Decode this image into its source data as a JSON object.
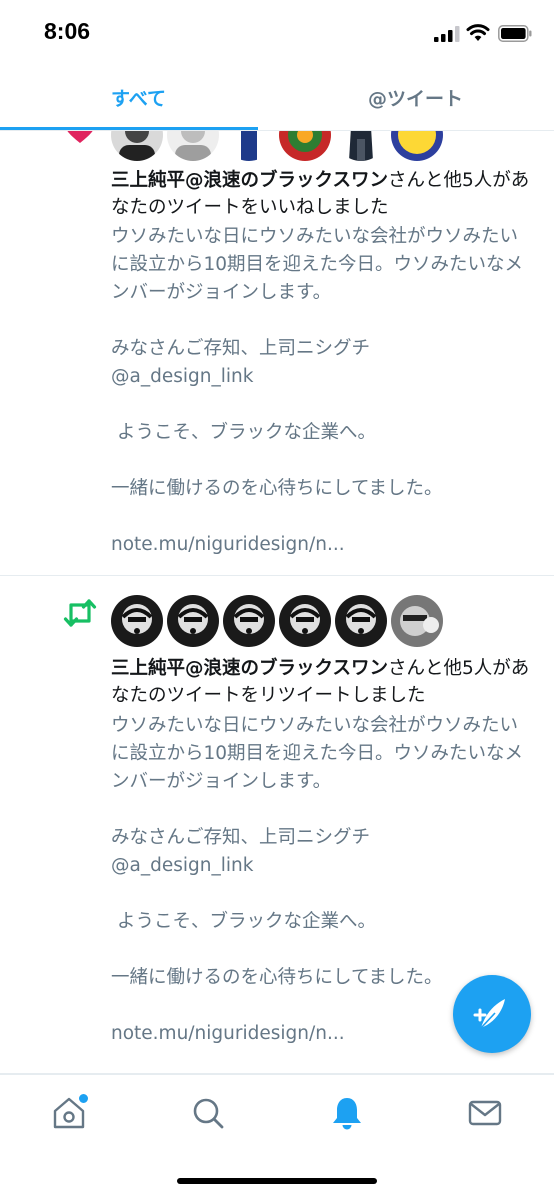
{
  "status_bar": {
    "time": "8:06"
  },
  "tabs": [
    {
      "label": "すべて",
      "active": true
    },
    {
      "label": "@ツイート",
      "active": false
    }
  ],
  "notifications": [
    {
      "type": "like",
      "actor": "三上純平@浪速のブラックスワン",
      "action": "さんと他5人があなたのツイートをいいねしました",
      "tweet_lines": [
        "ウソみたいな日にウソみたいな会社がウソみたいに設立から10期目を迎えた今日。ウソみたいなメンバーがジョインします。",
        "みなさんご存知、上司ニシグチ",
        "@a_design_link",
        "ようこそ、ブラックな企業へ。",
        "一緒に働けるのを心待ちにしてました。",
        "note.mu/niguridesign/n..."
      ]
    },
    {
      "type": "retweet",
      "actor": "三上純平@浪速のブラックスワン",
      "action": "さんと他5人があなたのツイートをリツイートしました",
      "tweet_lines": [
        "ウソみたいな日にウソみたいな会社がウソみたいに設立から10期目を迎えた今日。ウソみたいなメンバーがジョインします。",
        "みなさんご存知、上司ニシグチ",
        "@a_design_link",
        "ようこそ、ブラックな企業へ。",
        "一緒に働けるのを心待ちにしてました。",
        "note.mu/niguridesign/n..."
      ]
    }
  ],
  "nav": [
    "home-icon",
    "search-icon",
    "notifications-icon",
    "messages-icon"
  ],
  "colors": {
    "accent": "#1da1f2",
    "retweet": "#17bf63",
    "secondary_text": "#657786"
  }
}
